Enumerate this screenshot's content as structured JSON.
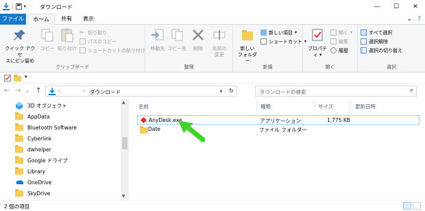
{
  "window": {
    "title": "ダウンロード",
    "minimize": "—",
    "maximize": "☐",
    "close": "✕"
  },
  "tabs": {
    "file": "ファイル",
    "home": "ホーム",
    "share": "共有",
    "view": "表示"
  },
  "ribbon": {
    "clipboard": {
      "pin_quick_access": [
        "クイック アクセ",
        "スにピン留め"
      ],
      "copy": "コピー",
      "paste": "貼り付け",
      "cut": "切り取り",
      "copy_path": "パスのコピー",
      "paste_shortcut": "ショートカットの貼り付け",
      "label": "クリップボード"
    },
    "organize": {
      "move_to": "移動先",
      "copy_to": "コピー先",
      "delete": "削除",
      "rename": [
        "名前の",
        "変更"
      ],
      "label": "整理"
    },
    "new": {
      "new_folder": [
        "新しい",
        "フォルダー"
      ],
      "new_item": "新しい項目",
      "shortcut": "ショートカット",
      "label": "新規"
    },
    "open": {
      "properties": "プロパティ",
      "open": "開く",
      "edit": "編集",
      "history": "履歴",
      "label": "開く"
    },
    "select": {
      "select_all": "すべて選択",
      "select_none": "選択解除",
      "invert": "選択の切り替え",
      "label": "選択"
    }
  },
  "address": {
    "path": "ダウンロード",
    "search_placeholder": "ダウンロードの検索"
  },
  "nav_items": [
    {
      "label": "3D オブジェクト",
      "icon": "3d-objects-icon"
    },
    {
      "label": "AppData",
      "icon": "folder-icon"
    },
    {
      "label": "Bluetooth Software",
      "icon": "folder-icon"
    },
    {
      "label": "Cyberlink",
      "icon": "folder-icon"
    },
    {
      "label": "dwhelper",
      "icon": "folder-icon"
    },
    {
      "label": "Google ドライブ",
      "icon": "folder-icon"
    },
    {
      "label": "Library",
      "icon": "folder-icon"
    },
    {
      "label": "OneDrive",
      "icon": "onedrive-icon"
    },
    {
      "label": "SkyDrive",
      "icon": "folder-icon"
    }
  ],
  "columns": {
    "name": "名前",
    "type": "種類",
    "size": "サイズ",
    "modified": "更新日時"
  },
  "files": [
    {
      "name": "AnyDesk.exe",
      "type": "アプリケーション",
      "size": "1,775 KB"
    },
    {
      "name": "Date",
      "type": "ファイル フォルダー",
      "size": ""
    }
  ],
  "status": {
    "count": "2 個の項目"
  },
  "colors": {
    "accent": "#1979ca",
    "arrow": "#3fd22a"
  }
}
